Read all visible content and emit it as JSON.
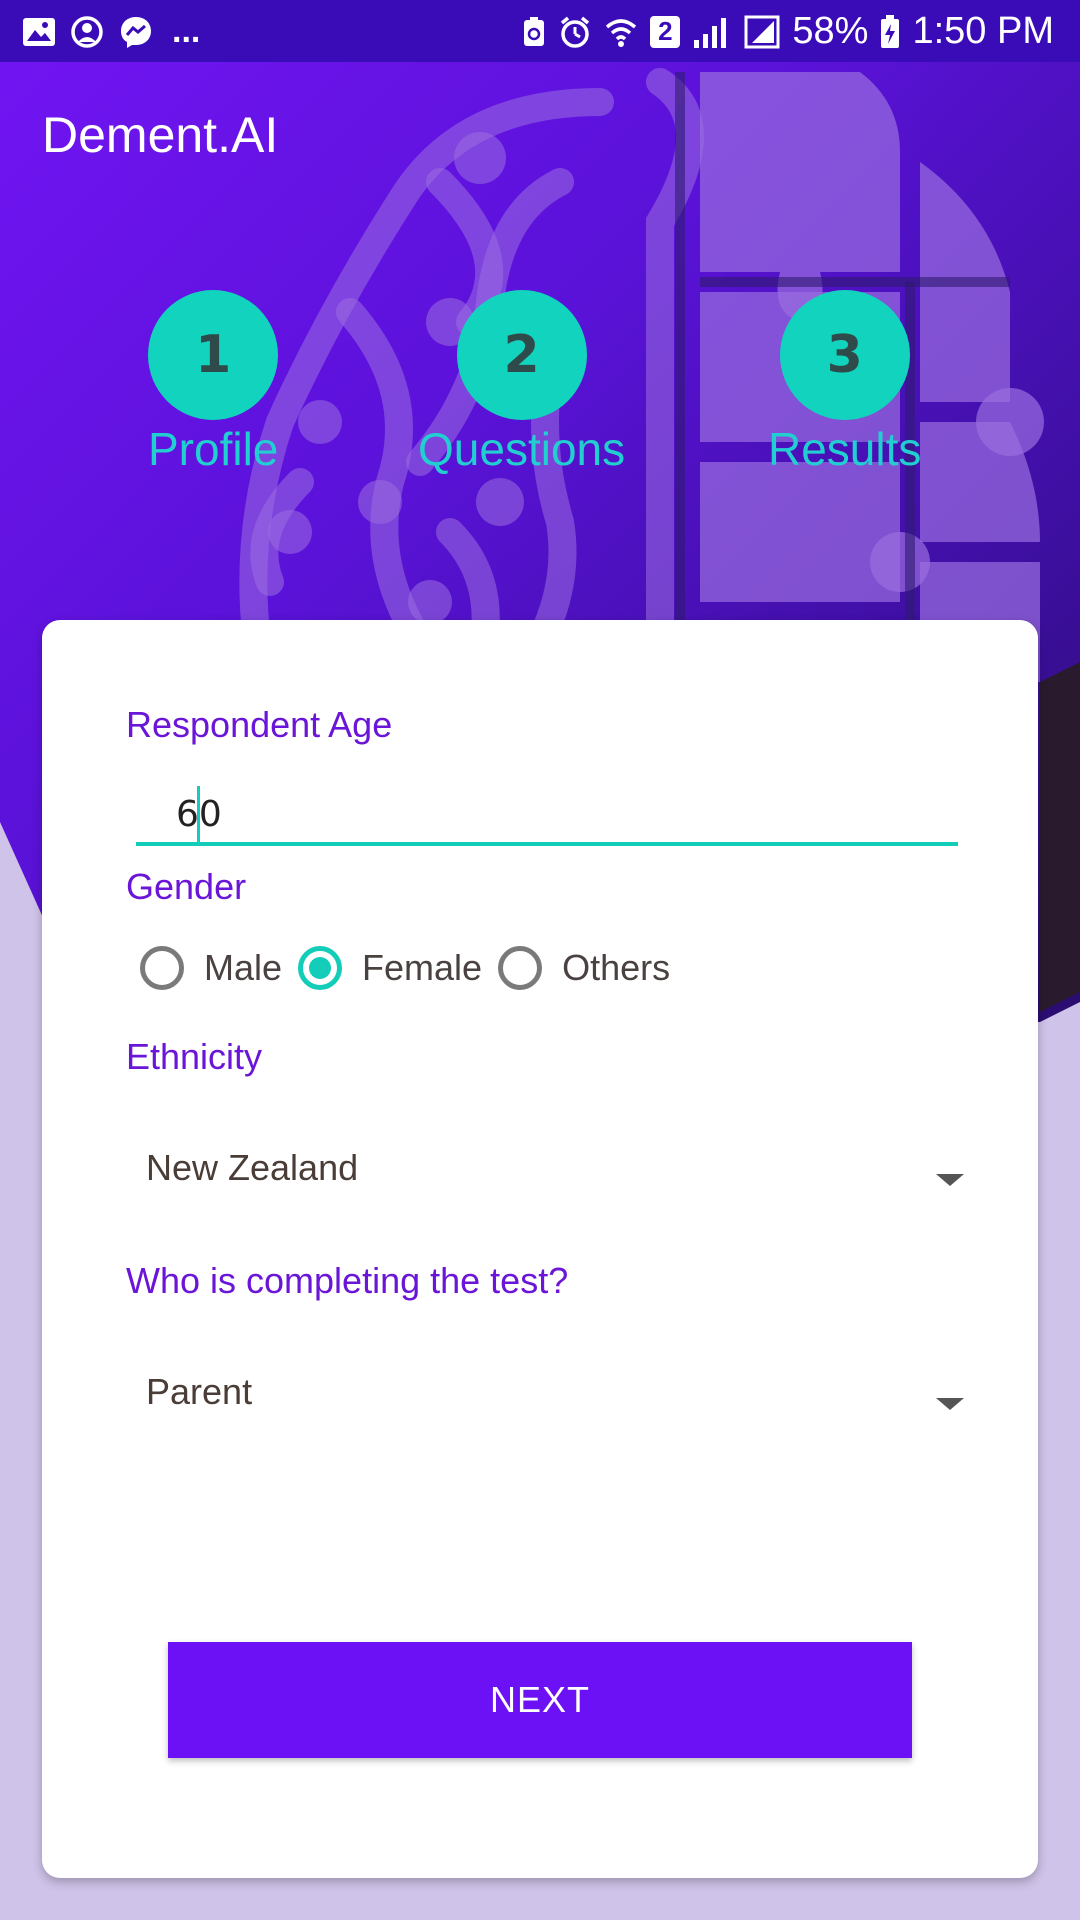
{
  "status_bar": {
    "left_icons": [
      "image-icon",
      "account-circle-icon",
      "messenger-icon"
    ],
    "overflow": "...",
    "sim_badge": "2",
    "battery_percent": "58%",
    "time": "1:50 PM"
  },
  "app": {
    "title": "Dement.AI"
  },
  "steps": [
    {
      "number": "1",
      "label": "Profile"
    },
    {
      "number": "2",
      "label": "Questions"
    },
    {
      "number": "3",
      "label": "Results"
    }
  ],
  "form": {
    "age": {
      "label": "Respondent Age",
      "value": "60"
    },
    "gender": {
      "label": "Gender",
      "options": [
        "Male",
        "Female",
        "Others"
      ],
      "selected": "Female"
    },
    "ethnicity": {
      "label": "Ethnicity",
      "value": "New Zealand"
    },
    "completer": {
      "label": "Who is completing the test?",
      "value": "Parent"
    },
    "next_label": "NEXT"
  },
  "colors": {
    "accent_purple": "#6c11f5",
    "teal": "#14cdb9",
    "label_purple": "#6a15d8"
  }
}
